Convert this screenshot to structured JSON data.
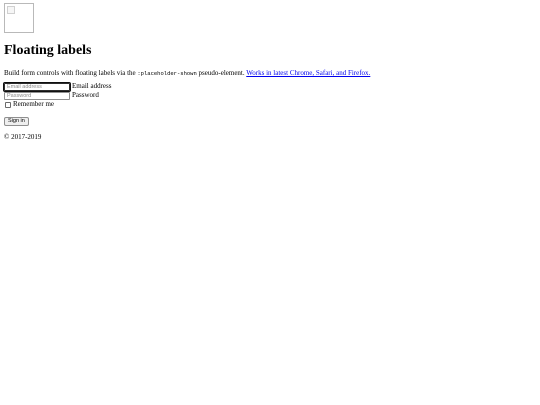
{
  "logo": {
    "icon": "broken-image-icon"
  },
  "heading": "Floating labels",
  "lead": {
    "text_before": "Build form controls with floating labels via the ",
    "code": ":placeholder-shown",
    "text_after": " pseudo-element. ",
    "link": "Works in latest Chrome, Safari, and Firefox."
  },
  "form": {
    "email": {
      "placeholder": "Email address",
      "value": "",
      "label": "Email address"
    },
    "password": {
      "placeholder": "Password",
      "value": "",
      "label": "Password"
    },
    "remember": {
      "label": "Remember me",
      "checked": false
    },
    "submit_label": "Sign in"
  },
  "footer": "© 2017-2019",
  "colors": {
    "link": "#0000ee",
    "text": "#000000",
    "background": "#ffffff"
  }
}
